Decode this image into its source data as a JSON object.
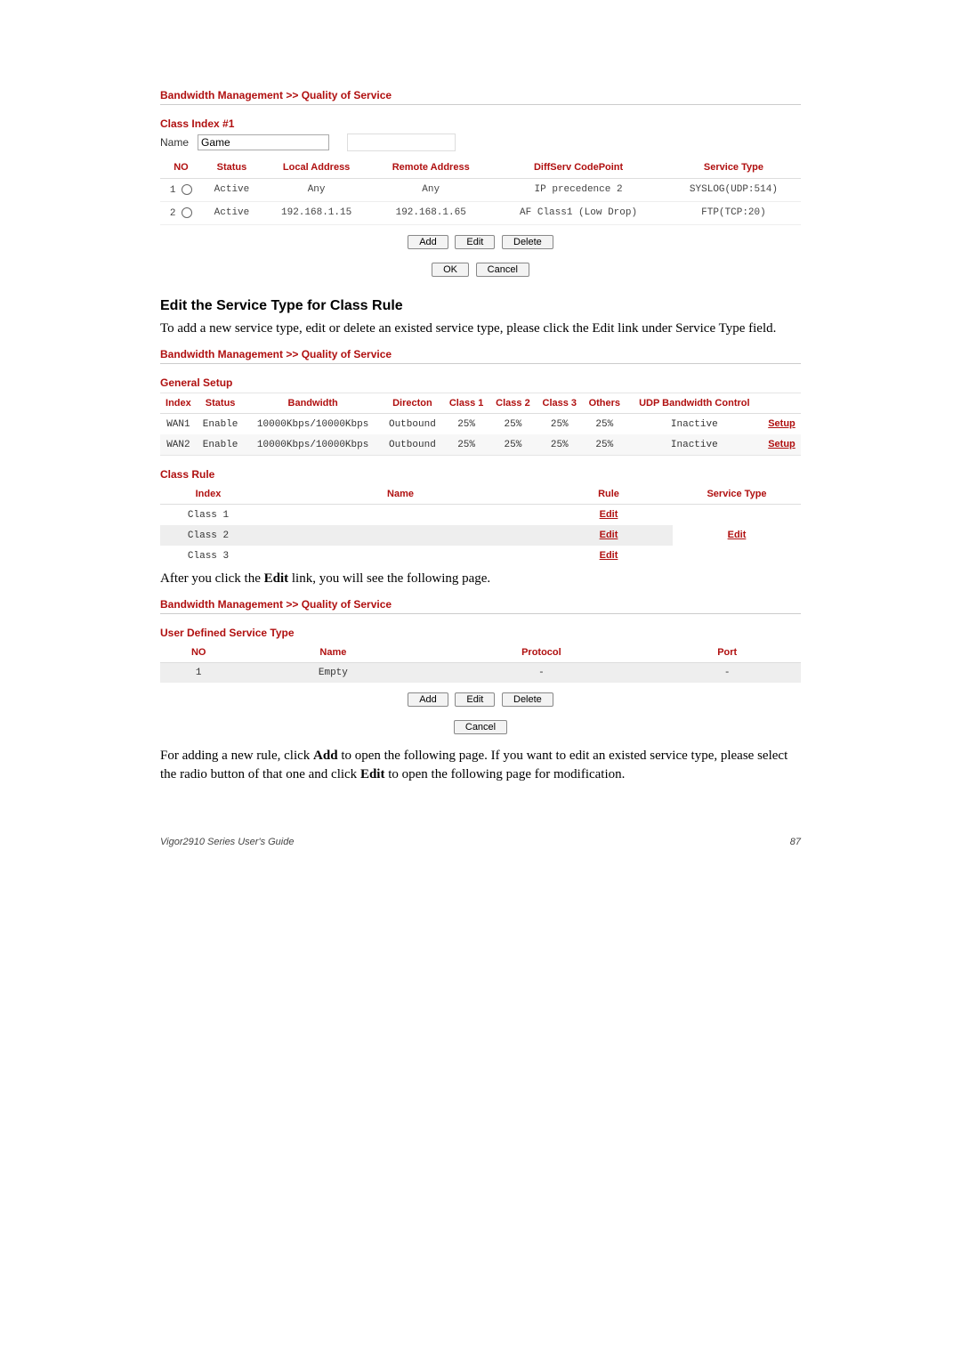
{
  "page_title_1": "Bandwidth Management >> Quality of Service",
  "class_index": {
    "heading": "Class Index #1",
    "name_label": "Name",
    "name_value": "Game",
    "headers": {
      "no": "NO",
      "status": "Status",
      "local": "Local Address",
      "remote": "Remote Address",
      "diffserv": "DiffServ CodePoint",
      "service": "Service Type"
    },
    "rows": [
      {
        "no": "1",
        "status": "Active",
        "local": "Any",
        "remote": "Any",
        "diffserv": "IP precedence 2",
        "service": "SYSLOG(UDP:514)"
      },
      {
        "no": "2",
        "status": "Active",
        "local": "192.168.1.15",
        "remote": "192.168.1.65",
        "diffserv": "AF Class1 (Low Drop)",
        "service": "FTP(TCP:20)"
      }
    ],
    "buttons": {
      "add": "Add",
      "edit": "Edit",
      "delete": "Delete",
      "ok": "OK",
      "cancel": "Cancel"
    }
  },
  "heading2": "Edit the Service Type for Class Rule",
  "para1": "To add a new service type, edit or delete an existed service type, please click the Edit link under Service Type field.",
  "page_title_2": "Bandwidth Management >> Quality of Service",
  "general_setup": {
    "heading": "General Setup",
    "headers": {
      "index": "Index",
      "status": "Status",
      "bandwidth": "Bandwidth",
      "direction": "Directon",
      "c1": "Class 1",
      "c2": "Class 2",
      "c3": "Class 3",
      "others": "Others",
      "udp": "UDP Bandwidth Control",
      "setup": ""
    },
    "rows": [
      {
        "index": "WAN1",
        "status": "Enable",
        "bw": "10000Kbps/10000Kbps",
        "dir": "Outbound",
        "c1": "25%",
        "c2": "25%",
        "c3": "25%",
        "oth": "25%",
        "udp": "Inactive",
        "setup": "Setup"
      },
      {
        "index": "WAN2",
        "status": "Enable",
        "bw": "10000Kbps/10000Kbps",
        "dir": "Outbound",
        "c1": "25%",
        "c2": "25%",
        "c3": "25%",
        "oth": "25%",
        "udp": "Inactive",
        "setup": "Setup"
      }
    ]
  },
  "class_rule": {
    "heading": "Class Rule",
    "headers": {
      "index": "Index",
      "name": "Name",
      "rule": "Rule",
      "service": "Service Type"
    },
    "rows": [
      {
        "index": "Class 1",
        "name": "",
        "rule": "Edit",
        "service": ""
      },
      {
        "index": "Class 2",
        "name": "",
        "rule": "Edit",
        "service": "Edit"
      },
      {
        "index": "Class 3",
        "name": "",
        "rule": "Edit",
        "service": ""
      }
    ]
  },
  "para2_pre": "After you click the ",
  "para2_bold": "Edit",
  "para2_post": " link, you will see the following page.",
  "page_title_3": "Bandwidth Management >> Quality of Service",
  "user_def": {
    "heading": "User Defined Service Type",
    "headers": {
      "no": "NO",
      "name": "Name",
      "protocol": "Protocol",
      "port": "Port"
    },
    "rows": [
      {
        "no": "1",
        "name": "Empty",
        "protocol": "-",
        "port": "-"
      }
    ],
    "buttons": {
      "add": "Add",
      "edit": "Edit",
      "delete": "Delete",
      "cancel": "Cancel"
    }
  },
  "para3_1": "For adding a new rule, click ",
  "para3_b1": "Add",
  "para3_2": " to open the following page. If you want to edit an existed service type, please select the radio button of that one and click ",
  "para3_b2": "Edit",
  "para3_3": " to open the following page for modification.",
  "footer_left": "Vigor2910 Series User's Guide",
  "footer_right": "87"
}
